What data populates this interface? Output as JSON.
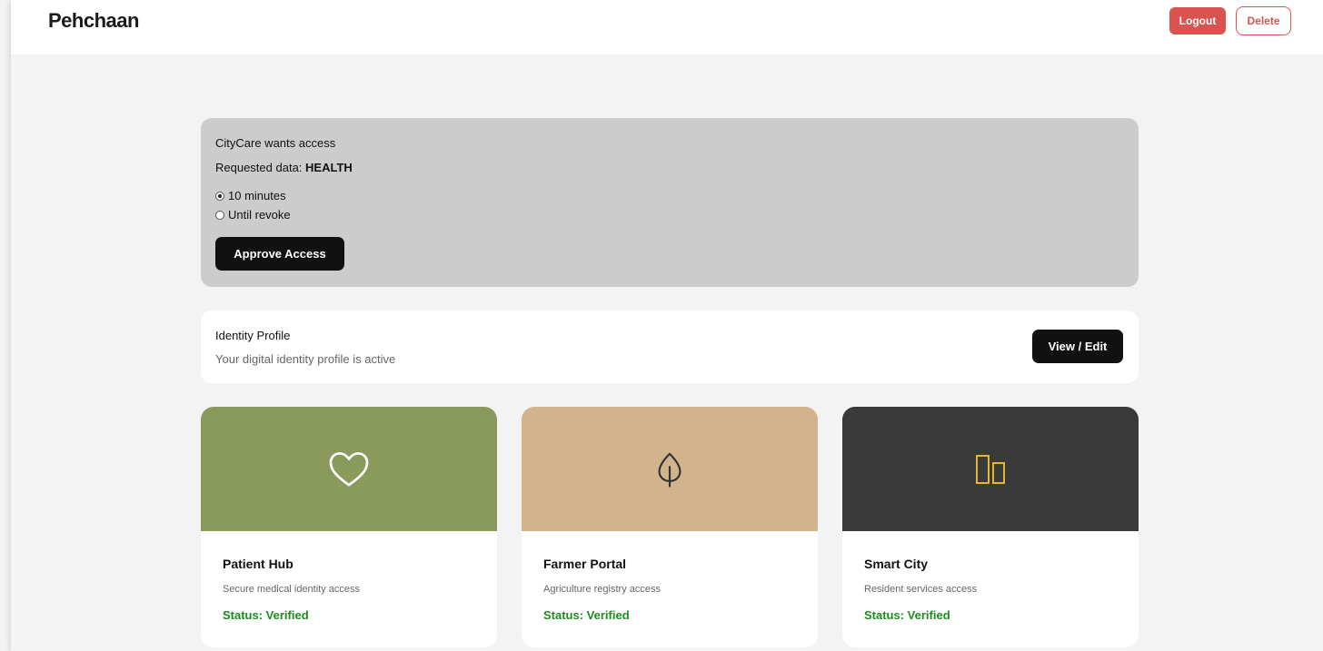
{
  "header": {
    "brand": "Pehchaan",
    "logout_label": "Logout",
    "delete_label": "Delete"
  },
  "request": {
    "requester_text": "CityCare wants access",
    "requested_prefix": "Requested data: ",
    "requested_value": "HEALTH",
    "options": [
      {
        "label": "10 minutes",
        "checked": true
      },
      {
        "label": "Until revoke",
        "checked": false
      }
    ],
    "approve_label": "Approve Access"
  },
  "profile": {
    "title": "Identity Profile",
    "subtitle": "Your digital identity profile is active",
    "button_label": "View / Edit"
  },
  "cards": [
    {
      "title": "Patient Hub",
      "description": "Secure medical identity access",
      "status": "Status: Verified",
      "banner_color": "#8a9a5b",
      "icon": "heart-icon",
      "icon_color": "#ffffff"
    },
    {
      "title": "Farmer Portal",
      "description": "Agriculture registry access",
      "status": "Status: Verified",
      "banner_color": "#d2b48c",
      "icon": "leaf-icon",
      "icon_color": "#333333"
    },
    {
      "title": "Smart City",
      "description": "Resident services access",
      "status": "Status: Verified",
      "banner_color": "#3a3a3a",
      "icon": "buildings-icon",
      "icon_color": "#e2b62e"
    }
  ],
  "colors": {
    "danger": "#d9534f",
    "verified": "#1f8a1f",
    "dark_button": "#111111",
    "request_bg": "#cccccc",
    "page_bg": "#f3f3f3"
  }
}
